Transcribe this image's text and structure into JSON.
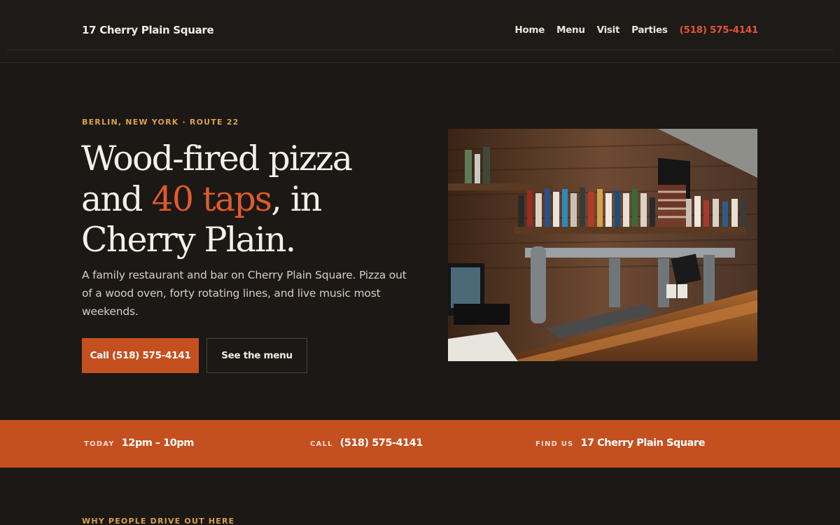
{
  "header": {
    "brand": "17 Cherry Plain Square",
    "nav": [
      "Home",
      "Menu",
      "Visit",
      "Parties"
    ],
    "phone": "(518) 575-4141"
  },
  "hero": {
    "eyebrow": "BERLIN, NEW YORK · ROUTE 22",
    "headline_part1": "Wood-fired pizza",
    "headline_part2": "and ",
    "headline_accent": "40 taps",
    "headline_part3": ", in",
    "headline_part4": "Cherry Plain.",
    "lede": "A family restaurant and bar on Cherry Plain Square. Pizza out of a wood oven, forty rotating lines, and live music most weekends.",
    "primary_button": "Call (518) 575-4141",
    "secondary_button": "See the menu"
  },
  "band": {
    "items": [
      {
        "label": "TODAY",
        "value": "12pm – 10pm"
      },
      {
        "label": "CALL",
        "value": "(518) 575-4141"
      },
      {
        "label": "FIND US",
        "value": "17 Cherry Plain Square"
      }
    ]
  },
  "section": {
    "eyebrow": "WHY PEOPLE DRIVE OUT HERE"
  },
  "colors": {
    "background": "#1b1816",
    "accent": "#c45020",
    "accent_text": "#e05a2c",
    "eyebrow": "#d9a24a"
  }
}
